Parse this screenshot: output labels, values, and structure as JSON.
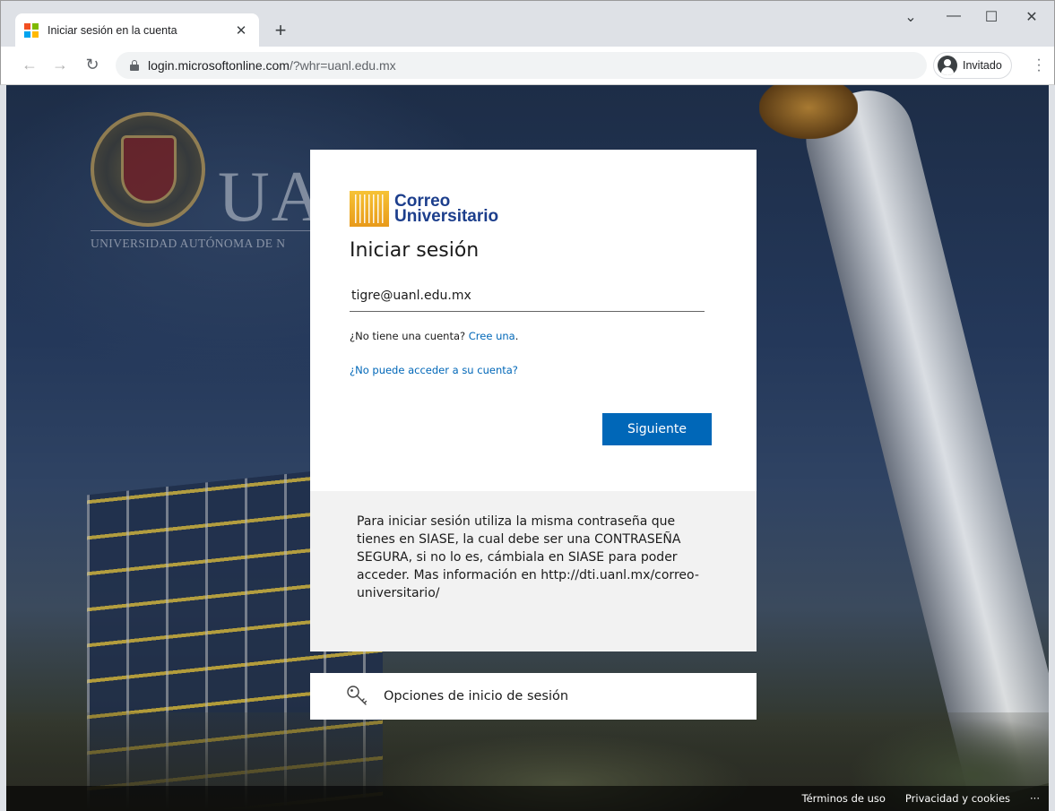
{
  "browser": {
    "tab_title": "Iniciar sesión en la cuenta",
    "tab_close": "✕",
    "new_tab": "+",
    "url_host": "login.microsoftonline.com",
    "url_path": "/?whr=uanl.edu.mx",
    "profile_label": "Invitado",
    "window_controls": {
      "dropdown": "⌄",
      "minimize": "—",
      "maximize": "☐",
      "close": "✕"
    }
  },
  "background": {
    "logo_text": "UAN",
    "university_name": "UNIVERSIDAD AUTÓNOMA DE N"
  },
  "signin": {
    "brand_line1": "Correo",
    "brand_line2": "Universitario",
    "title": "Iniciar sesión",
    "email_value": "tigre@uanl.edu.mx",
    "no_account_text": "¿No tiene una cuenta?",
    "create_link": "Cree una",
    "cant_access_link": "¿No puede acceder a su cuenta?",
    "next_button": "Siguiente",
    "info_text": "Para iniciar sesión utiliza la misma contraseña que tienes en SIASE, la cual debe ser una CONTRASEÑA SEGURA, si no lo es, cámbiala en SIASE para poder acceder. Mas información en http://dti.uanl.mx/correo-universitario/"
  },
  "options": {
    "label": "Opciones de inicio de sesión"
  },
  "footer": {
    "terms": "Términos de uso",
    "privacy": "Privacidad y cookies",
    "more": "···"
  },
  "colors": {
    "primary_button": "#0067b8",
    "link": "#0067b8",
    "brand_text": "#1c3e8c"
  }
}
